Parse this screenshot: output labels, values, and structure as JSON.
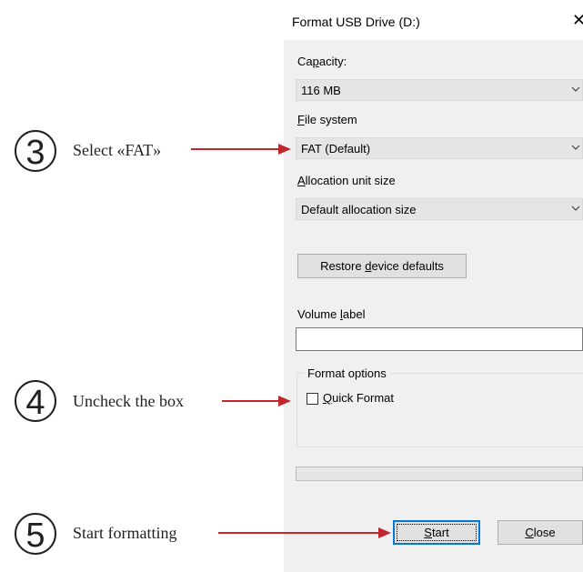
{
  "dialog": {
    "title": "Format USB Drive (D:)",
    "close_glyph": "✕",
    "capacity": {
      "label_pre": "Ca",
      "label_ul": "p",
      "label_post": "acity:",
      "value": "116 MB"
    },
    "file_system": {
      "label_ul": "F",
      "label_post": "ile system",
      "value": "FAT (Default)"
    },
    "allocation": {
      "label_ul": "A",
      "label_post": "llocation unit size",
      "value": "Default allocation size"
    },
    "restore_button": {
      "pre": "Restore ",
      "ul": "d",
      "post": "evice defaults"
    },
    "volume_label": {
      "pre": "Volume ",
      "ul": "l",
      "post": "abel",
      "value": ""
    },
    "format_options": {
      "pre": "Format ",
      "ul": "o",
      "post": "ptions"
    },
    "quick_format": {
      "ul": "Q",
      "post": "uick Format",
      "checked": false
    },
    "progress": 0,
    "start_button": {
      "ul": "S",
      "post": "tart"
    },
    "close_button": {
      "ul": "C",
      "post": "lose"
    }
  },
  "annotations": [
    {
      "number": "3",
      "text": "Select «FAT»"
    },
    {
      "number": "4",
      "text": "Uncheck the box"
    },
    {
      "number": "5",
      "text": "Start formatting"
    }
  ],
  "colors": {
    "arrow": "#c1272d",
    "dialog_bg": "#f0f0f0",
    "default_button_border": "#0078d7"
  }
}
